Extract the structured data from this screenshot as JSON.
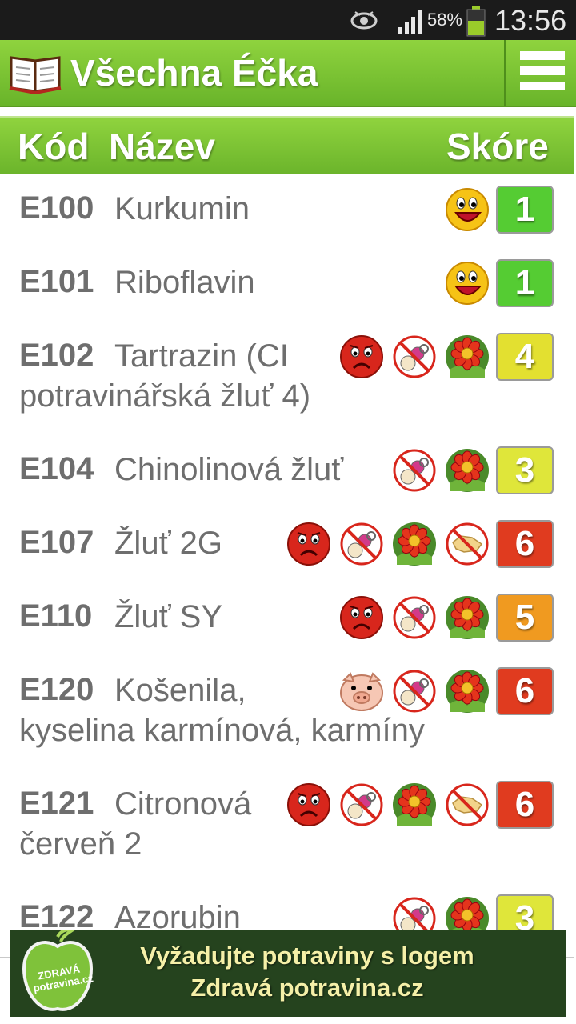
{
  "status_bar": {
    "battery": "58%",
    "time": "13:56"
  },
  "action_bar": {
    "title": "Všechna Éčka"
  },
  "table": {
    "headers": {
      "code": "Kód",
      "name": "Název",
      "score": "Skóre"
    },
    "rows": [
      {
        "code": "E100",
        "name": "Kurkumin",
        "name2": "",
        "icons": [
          "happy-face"
        ],
        "score": "1",
        "score_color": "#55cc33"
      },
      {
        "code": "E101",
        "name": "Riboflavin",
        "name2": "",
        "icons": [
          "happy-face"
        ],
        "score": "1",
        "score_color": "#55cc33"
      },
      {
        "code": "E102",
        "name": "Tartrazin (CI",
        "name2": "potravinářská žluť 4)",
        "icons": [
          "sad-face",
          "no-baby",
          "flower"
        ],
        "score": "4",
        "score_color": "#e3e030"
      },
      {
        "code": "E104",
        "name": "Chinolinová žluť",
        "name2": "",
        "icons": [
          "no-baby",
          "flower"
        ],
        "score": "3",
        "score_color": "#dfe63a"
      },
      {
        "code": "E107",
        "name": "Žluť 2G",
        "name2": "",
        "icons": [
          "sad-face",
          "no-baby",
          "flower",
          "no-czech"
        ],
        "score": "6",
        "score_color": "#e03b1f"
      },
      {
        "code": "E110",
        "name": "Žluť SY",
        "name2": "",
        "icons": [
          "sad-face",
          "no-baby",
          "flower"
        ],
        "score": "5",
        "score_color": "#f09a20"
      },
      {
        "code": "E120",
        "name": "Košenila,",
        "name2": "kyselina karmínová, karmíny",
        "icons": [
          "pig",
          "no-baby",
          "flower"
        ],
        "score": "6",
        "score_color": "#e03b1f"
      },
      {
        "code": "E121",
        "name": "Citronová",
        "name2": "červeň 2",
        "icons": [
          "sad-face",
          "no-baby",
          "flower",
          "no-czech"
        ],
        "score": "6",
        "score_color": "#e03b1f"
      },
      {
        "code": "E122",
        "name": "Azorubin",
        "name2": "",
        "icons": [
          "no-baby",
          "flower"
        ],
        "score": "3",
        "score_color": "#dfe63a"
      }
    ]
  },
  "ad": {
    "line1": "Vyžadujte potraviny s logem",
    "line2": "Zdravá potravina.cz",
    "logo_text": "ZDRAVÁ potravina.cz"
  }
}
